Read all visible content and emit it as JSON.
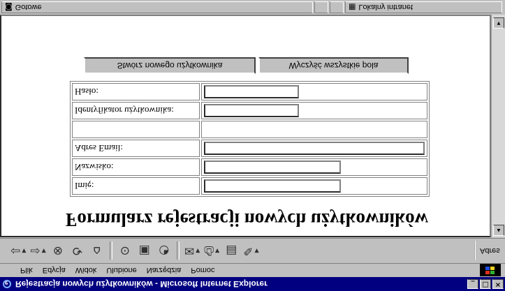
{
  "window": {
    "title": "Rejestracja nowych użytkowników - Microsoft Internet Explorer",
    "minimize": "_",
    "maximize": "□",
    "close": "×"
  },
  "menu": {
    "items": [
      "Plik",
      "Edycja",
      "Widok",
      "Ulubione",
      "Narzędzia",
      "Pomoc"
    ]
  },
  "toolbar": {
    "address_label": "Adres"
  },
  "page": {
    "heading": "Formularz rejestracji nowych użytkowników",
    "fields": [
      {
        "label": "Imię:",
        "value": ""
      },
      {
        "label": "Nazwisko:",
        "value": ""
      },
      {
        "label": "Adres Email:",
        "value": ""
      },
      {
        "label": "",
        "value": ""
      },
      {
        "label": "Identyfikator użytkownika:",
        "value": ""
      },
      {
        "label": "Hasło:",
        "value": ""
      }
    ],
    "buttons": {
      "clear": "Wyczyść wszystkie pola",
      "create": "Stwórz nowego użytkownika"
    }
  },
  "status": {
    "text": "Gotowe",
    "zone": "Lokalny intranet"
  }
}
